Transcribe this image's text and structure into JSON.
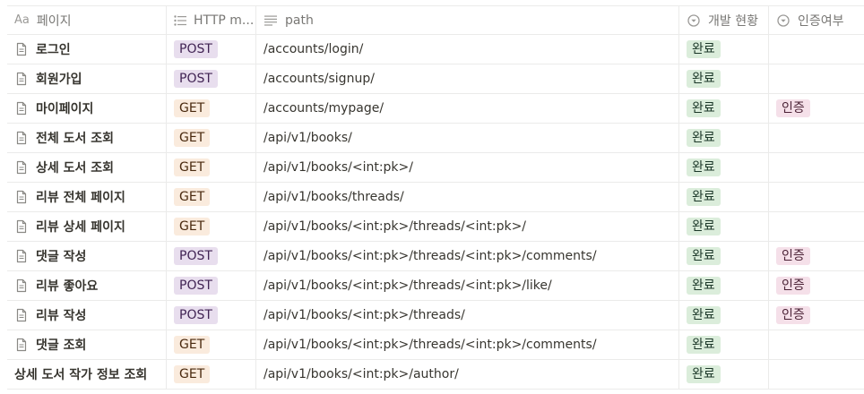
{
  "columns": {
    "name": "페이지",
    "name_icon": "Aa",
    "method": "HTTP m...",
    "path": "path",
    "status": "개발 현황",
    "auth": "인증여부"
  },
  "rows": [
    {
      "name": "로그인",
      "has_icon": true,
      "method": "POST",
      "path": "/accounts/login/",
      "status": "완료",
      "auth": ""
    },
    {
      "name": "회원가입",
      "has_icon": true,
      "method": "POST",
      "path": "/accounts/signup/",
      "status": "완료",
      "auth": ""
    },
    {
      "name": "마이페이지",
      "has_icon": true,
      "method": "GET",
      "path": "/accounts/mypage/",
      "status": "완료",
      "auth": "인증"
    },
    {
      "name": "전체 도서 조회",
      "has_icon": true,
      "method": "GET",
      "path": "/api/v1/books/",
      "status": "완료",
      "auth": ""
    },
    {
      "name": "상세 도서 조회",
      "has_icon": true,
      "method": "GET",
      "path": "/api/v1/books/<int:pk>/",
      "status": "완료",
      "auth": ""
    },
    {
      "name": "리뷰 전체 페이지",
      "has_icon": true,
      "method": "GET",
      "path": "/api/v1/books/threads/",
      "status": "완료",
      "auth": ""
    },
    {
      "name": "리뷰 상세 페이지",
      "has_icon": true,
      "method": "GET",
      "path": "/api/v1/books/<int:pk>/threads/<int:pk>/",
      "status": "완료",
      "auth": ""
    },
    {
      "name": "댓글 작성",
      "has_icon": true,
      "method": "POST",
      "path": "/api/v1/books/<int:pk>/threads/<int:pk>/comments/",
      "status": "완료",
      "auth": "인증"
    },
    {
      "name": "리뷰 좋아요",
      "has_icon": true,
      "method": "POST",
      "path": "/api/v1/books/<int:pk>/threads/<int:pk>/like/",
      "status": "완료",
      "auth": "인증"
    },
    {
      "name": "리뷰 작성",
      "has_icon": true,
      "method": "POST",
      "path": "/api/v1/books/<int:pk>/threads/",
      "status": "완료",
      "auth": "인증"
    },
    {
      "name": "댓글 조회",
      "has_icon": true,
      "method": "GET",
      "path": "/api/v1/books/<int:pk>/threads/<int:pk>/comments/",
      "status": "완료",
      "auth": ""
    },
    {
      "name": "상세 도서 작가 정보 조회",
      "has_icon": false,
      "method": "GET",
      "path": "/api/v1/books/<int:pk>/author/",
      "status": "완료",
      "auth": ""
    }
  ]
}
